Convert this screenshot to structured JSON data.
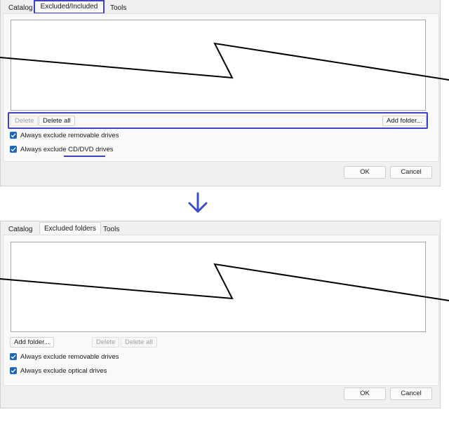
{
  "before": {
    "tabs": [
      "Catalog",
      "Excluded/Included",
      "Tools"
    ],
    "buttons": {
      "delete": "Delete",
      "delete_all": "Delete all",
      "add_folder": "Add folder..."
    },
    "checks": {
      "removable": "Always exclude removable drives",
      "optical_prefix": "Always exclude ",
      "optical_highlight": "CD/DVD drives"
    },
    "ok": "OK",
    "cancel": "Cancel"
  },
  "after": {
    "tabs": [
      "Catalog",
      "Excluded folders",
      "Tools"
    ],
    "buttons": {
      "add_folder": "Add folder...",
      "delete": "Delete",
      "delete_all": "Delete all"
    },
    "checks": {
      "removable": "Always exclude removable drives",
      "optical": "Always exclude optical drives"
    },
    "ok": "OK",
    "cancel": "Cancel"
  },
  "colors": {
    "highlight": "#4040c8",
    "checkbox": "#1f67b8",
    "arrow": "#3a4fc7"
  }
}
